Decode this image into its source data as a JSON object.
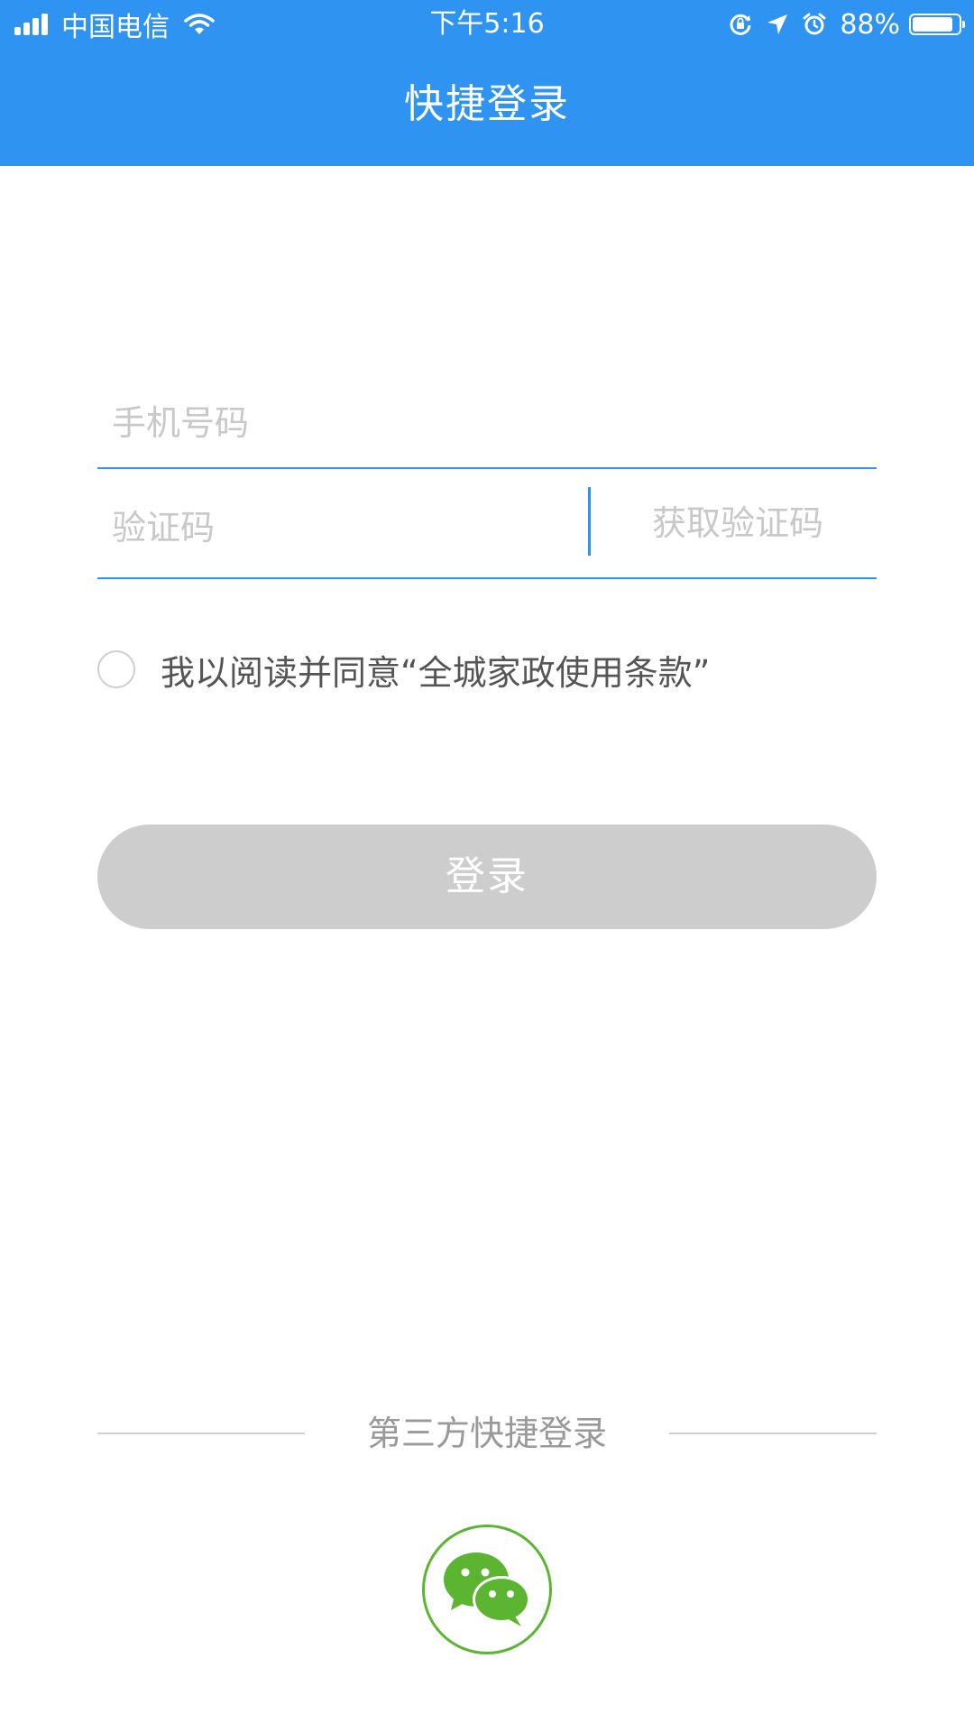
{
  "status_bar": {
    "carrier": "中国电信",
    "time": "下午5:16",
    "battery": "88%",
    "battery_level": 0.88
  },
  "nav": {
    "title": "快捷登录"
  },
  "form": {
    "phone_placeholder": "手机号码",
    "code_placeholder": "验证码",
    "get_code_label": "获取验证码",
    "agreement_text": "我以阅读并同意“全城家政使用条款”",
    "login_label": "登录"
  },
  "third_party": {
    "label": "第三方快捷登录",
    "icon": "wechat-icon"
  },
  "colors": {
    "primary": "#2f93f1",
    "disabled_button": "#cdcdcd",
    "wechat_green": "#5cb531"
  }
}
